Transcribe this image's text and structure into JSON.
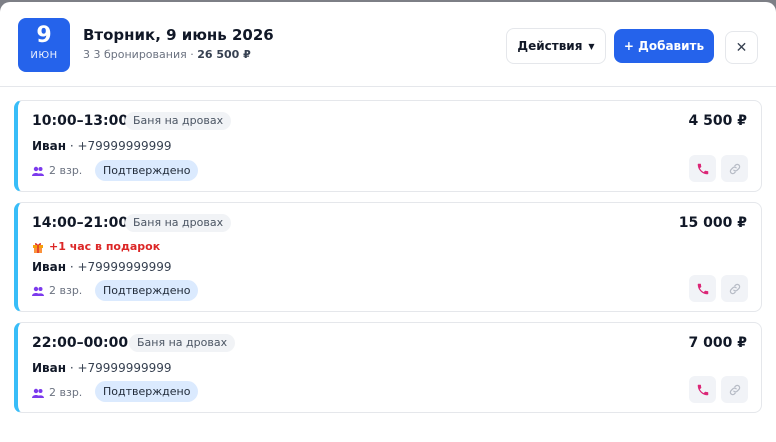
{
  "header": {
    "day": "9",
    "month": "ИЮН",
    "title": "Вторник, 9 июнь 2026",
    "subtitle_count": "3 3 бронирования · ",
    "subtitle_sum": "26 500 ₽",
    "actions_label": "Действия",
    "add_label": "+ Добавить",
    "close_symbol": "✕"
  },
  "bookings": [
    {
      "time": "10:00–13:00",
      "service": "Баня на дровах",
      "price": "4 500 ₽",
      "name": "Иван",
      "phone": " · +79999999999",
      "guests": "2 взр.",
      "status": "Подтверждено"
    },
    {
      "time": "14:00–21:00",
      "service": "Баня на дровах",
      "price": "15 000 ₽",
      "gift": "+1 час в подарок",
      "name": "Иван",
      "phone": " · +79999999999",
      "guests": "2 взр.",
      "status": "Подтверждено"
    },
    {
      "time": "22:00–00:00",
      "service": "Баня на дровах",
      "price": "7 000 ₽",
      "name": "Иван",
      "phone": " · +79999999999",
      "guests": "2 взр.",
      "status": "Подтверждено"
    }
  ],
  "colors": {
    "accent": "#2563eb",
    "card_stripe": "#38bdf8",
    "gift": "#dc2626",
    "status_bg": "#dbeafe",
    "phone_icon": "#db2777"
  },
  "icons": {
    "phone": "phone-icon",
    "link": "link-icon",
    "guests": "users-icon",
    "gift": "gift-icon",
    "close": "close-icon",
    "caret": "chevron-down-icon"
  }
}
